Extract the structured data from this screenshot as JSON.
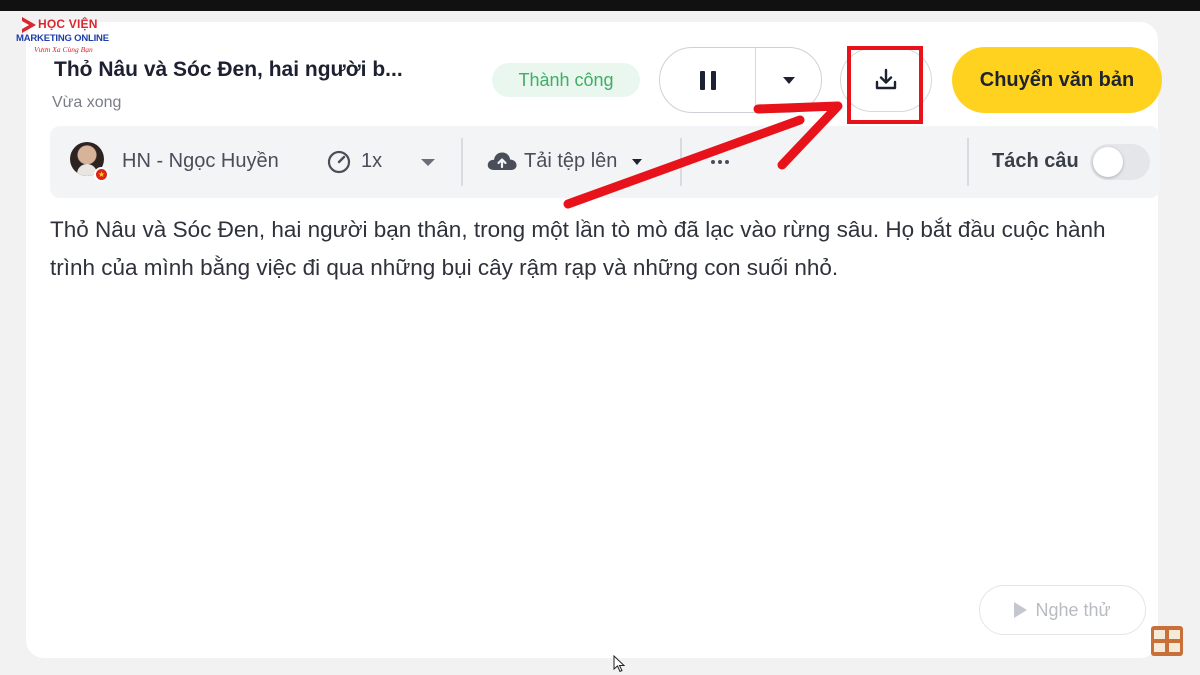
{
  "logo": {
    "line1": "HỌC VIỆN",
    "line2": "MARKETING ONLINE",
    "line3": "Vươn Xa Cùng Bạn"
  },
  "header": {
    "title": "Thỏ Nâu và Sóc Đen, hai người b...",
    "subtitle": "Vừa xong",
    "status": "Thành công",
    "convert_label": "Chuyển văn bản"
  },
  "toolbar": {
    "voice_name": "HN - Ngọc Huyền",
    "speed": "1x",
    "upload_label": "Tải tệp lên",
    "split_label": "Tách câu",
    "split_enabled": false
  },
  "content": {
    "text": "Thỏ Nâu và Sóc Đen, hai người bạn thân, trong một lần tò mò đã lạc vào rừng sâu. Họ bắt đầu cuộc hành trình của mình bằng việc đi qua những bụi cây rậm rạp và những con suối nhỏ."
  },
  "footer": {
    "preview_label": "Nghe thử"
  },
  "colors": {
    "accent_yellow": "#ffd21f",
    "success_green": "#3fae66",
    "annotation_red": "#e8121a"
  },
  "icons": [
    "pause-icon",
    "chevron-down-icon",
    "download-icon",
    "speed-icon",
    "cloud-upload-icon",
    "more-icon",
    "play-icon"
  ]
}
